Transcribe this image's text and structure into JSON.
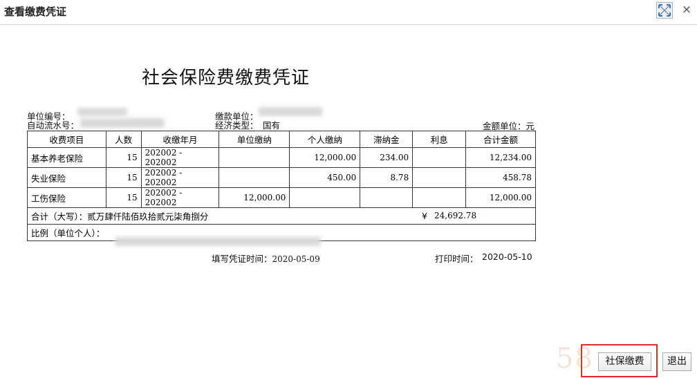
{
  "window": {
    "title": "查看缴费凭证",
    "close_label": "×"
  },
  "document": {
    "title": "社会保险费缴费凭证",
    "unit_code_label": "单位编号：",
    "serial_label": "自动流水号：",
    "payer_label": "缴款单位：",
    "econ_type_label": "经济类型：",
    "econ_type_value": "国有",
    "currency_unit": "金额单位：元"
  },
  "table": {
    "headers": [
      "收费项目",
      "人数",
      "收缴年月",
      "单位缴纳",
      "个人缴纳",
      "滞纳金",
      "利息",
      "合计金额"
    ],
    "rows": [
      [
        "基本养老保险",
        "15",
        "202002  -  202002",
        "",
        "12,000.00",
        "234.00",
        "",
        "12,234.00"
      ],
      [
        "失业保险",
        "15",
        "202002  -  202002",
        "",
        "450.00",
        "8.78",
        "",
        "458.78"
      ],
      [
        "工伤保险",
        "15",
        "202002  -  202002",
        "12,000.00",
        "",
        "",
        "",
        "12,000.00"
      ]
    ],
    "total_label": "合计（大写）：贰万肆仟陆佰玖拾贰元柒角捌分",
    "total_symbol": "¥",
    "total_value": "24,692.78",
    "ratio_label": "比例（单位个人）："
  },
  "footer": {
    "fill_time_label": "填写凭证时间：",
    "fill_time_value": "2020-05-09",
    "print_time_label": "打印时间：",
    "print_time_value": "2020-05-10"
  },
  "watermark": "58",
  "buttons": {
    "pay": "社保缴费",
    "exit": "退出"
  }
}
